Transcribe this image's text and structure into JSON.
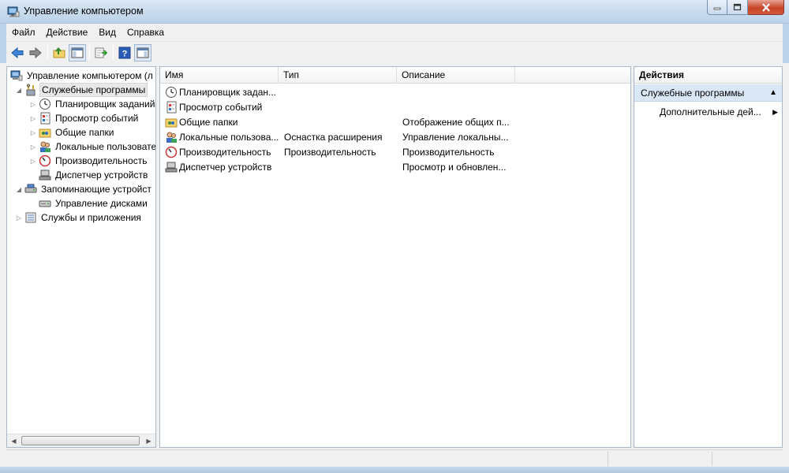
{
  "window": {
    "title": "Управление компьютером",
    "icon": "computer-management-icon",
    "buttons": [
      "minimize-icon",
      "maximize-icon",
      "close-icon"
    ]
  },
  "menu": [
    "Файл",
    "Действие",
    "Вид",
    "Справка"
  ],
  "toolbar": [
    "back-arrow-icon",
    "forward-arrow-icon",
    "up-folder-icon",
    "show-hide-tree-icon",
    "export-list-icon",
    "help-icon",
    "show-hide-action-pane-icon"
  ],
  "tree": {
    "items": [
      {
        "label": "Управление компьютером (л",
        "icon": "computer-management-icon",
        "arrow": ""
      },
      {
        "label": "Служебные программы",
        "icon": "tools-icon",
        "arrow": "◢"
      },
      {
        "label": "Планировщик заданий",
        "icon": "clock-icon",
        "arrow": "▷"
      },
      {
        "label": "Просмотр событий",
        "icon": "event-viewer-icon",
        "arrow": "▷"
      },
      {
        "label": "Общие папки",
        "icon": "shared-folders-icon",
        "arrow": "▷"
      },
      {
        "label": "Локальные пользовате",
        "icon": "users-icon",
        "arrow": "▷"
      },
      {
        "label": "Производительность",
        "icon": "performance-icon",
        "arrow": "▷"
      },
      {
        "label": "Диспетчер устройств",
        "icon": "device-manager-icon",
        "arrow": ""
      },
      {
        "label": "Запоминающие устройст",
        "icon": "storage-icon",
        "arrow": "◢"
      },
      {
        "label": "Управление дисками",
        "icon": "disk-management-icon",
        "arrow": ""
      },
      {
        "label": "Службы и приложения",
        "icon": "services-icon",
        "arrow": "▷"
      }
    ]
  },
  "list": {
    "columns": [
      "Имя",
      "Тип",
      "Описание"
    ],
    "rows": [
      {
        "name": "Планировщик задан...",
        "type": "",
        "desc": "",
        "icon": "clock-icon"
      },
      {
        "name": "Просмотр событий",
        "type": "",
        "desc": "",
        "icon": "event-viewer-icon"
      },
      {
        "name": "Общие папки",
        "type": "",
        "desc": "Отображение общих п...",
        "icon": "shared-folders-icon"
      },
      {
        "name": "Локальные пользова...",
        "type": "Оснастка расширения",
        "desc": "Управление локальны...",
        "icon": "users-icon"
      },
      {
        "name": "Производительность",
        "type": "Производительность",
        "desc": "Производительность",
        "icon": "performance-icon"
      },
      {
        "name": "Диспетчер устройств",
        "type": "",
        "desc": "Просмотр и обновлен...",
        "icon": "device-manager-icon"
      }
    ]
  },
  "actions": {
    "header": "Действия",
    "section": "Служебные программы",
    "item": "Дополнительные дей..."
  }
}
